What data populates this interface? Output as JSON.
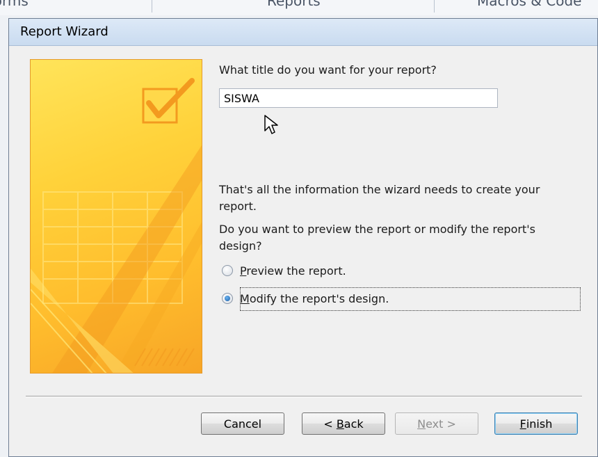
{
  "background_tabs": [
    "Forms",
    "Reports",
    "Macros & Code"
  ],
  "dialog": {
    "title": "Report Wizard"
  },
  "wizard": {
    "title_question": "What title do you want for your report?",
    "title_value": "SISWA",
    "info_text": "That's all the information the wizard needs to create your report.",
    "preview_question": "Do you want to preview the report or modify the report's design?",
    "options": [
      {
        "label_prefix": "",
        "accel": "P",
        "label_rest": "review the report.",
        "selected": false
      },
      {
        "label_prefix": "",
        "accel": "M",
        "label_rest": "odify the report's design.",
        "selected": true
      }
    ]
  },
  "buttons": {
    "cancel": "Cancel",
    "back_prefix": "< ",
    "back_accel": "B",
    "back_rest": "ack",
    "next_accel": "N",
    "next_rest": "ext >",
    "finish_accel": "F",
    "finish_rest": "inish",
    "next_enabled": false
  },
  "colors": {
    "art_border": "#e59a2c",
    "art_fill": "#ffd23a",
    "radio_selected": "#1c5fa8"
  },
  "icons": [
    "checkmark-icon",
    "radio-icon",
    "mouse-pointer-icon"
  ]
}
